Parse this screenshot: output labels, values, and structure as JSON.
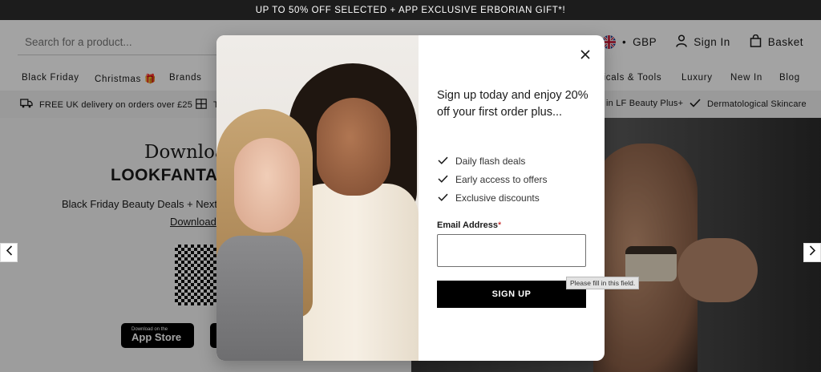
{
  "topbar": {
    "promo_text": "UP TO 50% OFF SELECTED + APP EXCLUSIVE ERBORIAN GIFT*!"
  },
  "header": {
    "search_placeholder": "Search for a product...",
    "currency_symbol": "•",
    "currency": "GBP",
    "sign_in": "Sign In",
    "basket": "Basket"
  },
  "nav": {
    "items": [
      "Black Friday",
      "Christmas",
      "Brands",
      "ricals & Tools",
      "Luxury",
      "New In",
      "Blog"
    ]
  },
  "usp": {
    "items": [
      "FREE UK delivery on orders over £25",
      "T",
      "in LF Beauty Plus+",
      "Dermatological Skincare"
    ]
  },
  "hero": {
    "heading_line1": "Downloa",
    "heading_line2": "LOOKFANTA",
    "subtext": "Black Friday Beauty Deals + Next",
    "link": "Download",
    "appstore_small": "Download on the",
    "appstore_large": "App Store"
  },
  "modal": {
    "headline": "Sign up today and enjoy 20% off your first order plus...",
    "benefits": [
      "Daily flash deals",
      "Early access to offers",
      "Exclusive discounts"
    ],
    "email_label": "Email Address",
    "required_mark": "*",
    "email_value": "",
    "signup_button": "SIGN UP",
    "tooltip": "Please fill in this field."
  },
  "colors": {
    "topbar_bg": "#1c1c1c",
    "button_bg": "#000000",
    "overlay": "rgba(0,0,0,0.36)"
  }
}
